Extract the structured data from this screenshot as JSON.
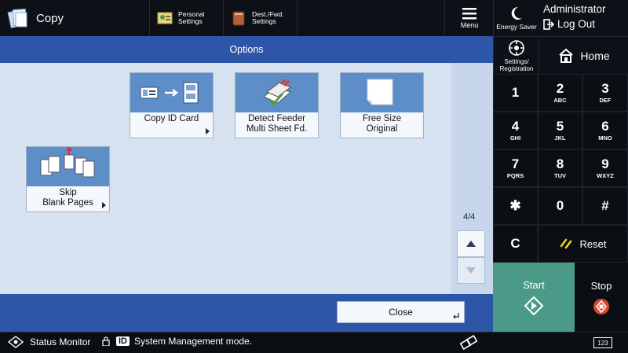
{
  "header": {
    "app_title": "Copy",
    "personal_settings": "Personal\nSettings",
    "personal_settings_l1": "Personal",
    "personal_settings_l2": "Settings",
    "dest_fwd_l1": "Dest./Fwd.",
    "dest_fwd_l2": "Settings",
    "menu_label": "Menu"
  },
  "session": {
    "energy_saver_label": "Energy Saver",
    "user": "Administrator",
    "logout_label": "Log Out",
    "settings_l1": "Settings/",
    "settings_l2": "Registration",
    "home_label": "Home"
  },
  "panel": {
    "title": "Options",
    "page_indicator": "4/4",
    "close_label": "Close",
    "functions": [
      {
        "line1": "Copy ID Card",
        "line2": ""
      },
      {
        "line1": "Detect Feeder",
        "line2": "Multi Sheet Fd."
      },
      {
        "line1": "Free Size",
        "line2": "Original"
      },
      {
        "line1": "Skip",
        "line2": "Blank Pages"
      }
    ]
  },
  "keypad": {
    "keys": [
      {
        "num": "1",
        "sub": ""
      },
      {
        "num": "2",
        "sub": "ABC"
      },
      {
        "num": "3",
        "sub": "DEF"
      },
      {
        "num": "4",
        "sub": "GHI"
      },
      {
        "num": "5",
        "sub": "JKL"
      },
      {
        "num": "6",
        "sub": "MNO"
      },
      {
        "num": "7",
        "sub": "PQRS"
      },
      {
        "num": "8",
        "sub": "TUV"
      },
      {
        "num": "9",
        "sub": "WXYZ"
      },
      {
        "num": "✱",
        "sub": ""
      },
      {
        "num": "0",
        "sub": ""
      },
      {
        "num": "#",
        "sub": ""
      },
      {
        "num": "C",
        "sub": ""
      }
    ],
    "reset_label": "Reset",
    "start_label": "Start",
    "stop_label": "Stop"
  },
  "status_bar": {
    "status_monitor": "Status Monitor",
    "id_badge": "ID",
    "message": "System Management mode.",
    "counter_label": "123"
  },
  "colors": {
    "panel_blue": "#2e56a8",
    "content_bg": "#d6e2f0",
    "start_green": "#4a9a87",
    "stop_red": "#d8482f",
    "reset_yellow": "#e8d21f"
  }
}
